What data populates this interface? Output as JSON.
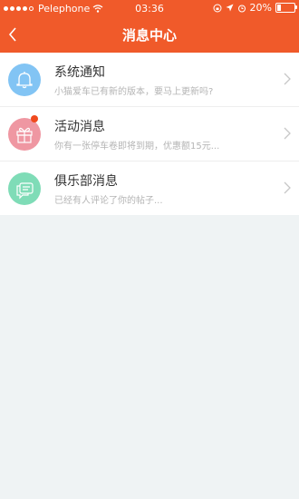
{
  "status_bar": {
    "carrier": "Pelephone",
    "time": "03:36",
    "battery": "20%"
  },
  "header": {
    "title": "消息中心"
  },
  "messages": [
    {
      "title": "系统通知",
      "preview": "小猫爱车已有新的版本，要马上更新吗?",
      "icon": "bell-icon",
      "color": "#82c4f4"
    },
    {
      "title": "活动消息",
      "preview": "你有一张停车卷即将到期，优惠额15元...",
      "icon": "gift-icon",
      "color": "#ef97a2",
      "unread_dot": true
    },
    {
      "title": "俱乐部消息",
      "preview": "已经有人评论了你的帖子...",
      "icon": "chat-icon",
      "color": "#7fdcb7"
    }
  ],
  "colors": {
    "header": "#f05a2a",
    "background": "#eff3f4"
  }
}
